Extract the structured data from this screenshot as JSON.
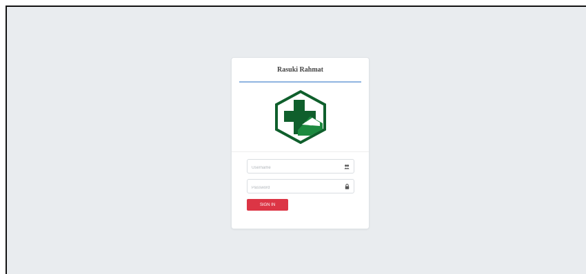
{
  "card": {
    "title": "Rasuki Rahmat"
  },
  "form": {
    "username": {
      "value": "",
      "placeholder": "Username",
      "icon": "user-icon"
    },
    "password": {
      "value": "",
      "placeholder": "Password",
      "icon": "lock-icon"
    },
    "submit_label": "SIGN IN"
  },
  "logo": {
    "icon": "health-cross-logo",
    "colors": {
      "dark_green": "#0f5f2c",
      "green": "#1c8a3f",
      "white": "#ffffff"
    }
  },
  "colors": {
    "background": "#e9ecef",
    "accent_line": "#8fb4e0",
    "button": "#dc3545"
  }
}
